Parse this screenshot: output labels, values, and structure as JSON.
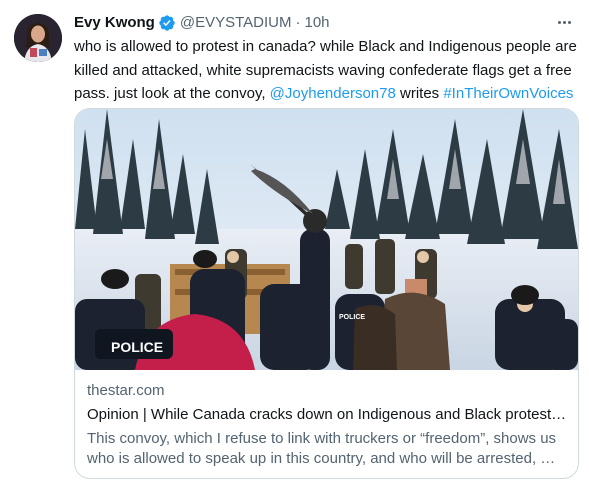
{
  "author": {
    "name": "Evy Kwong",
    "handle": "@EVYSTADIUM",
    "separator": "·",
    "time": "10h",
    "verified": true
  },
  "tweet": {
    "text_part1": "who is allowed to protest in canada? while Black and Indigenous people are killed and attacked, white supremacists waving confederate flags get a free pass. just look at the convoy, ",
    "mention": "@Joyhenderson78",
    "text_part2": " writes ",
    "hashtag": "#InTheirOwnVoices"
  },
  "card": {
    "domain": "thestar.com",
    "title": "Opinion | While Canada cracks down on Indigenous and Black protest…",
    "description": "This convoy, which I refuse to link with truckers or “freedom”, shows us who is allowed to speak up in this country, and who will be arrested, …",
    "image_text": {
      "police_label": "POLICE",
      "police_badge_small": "POLICE"
    }
  },
  "colors": {
    "accent": "#1d9bf0",
    "text_primary": "#0f1419",
    "text_secondary": "#536471",
    "border": "#cfd9de"
  },
  "icons": {
    "verified": "verified-badge-icon",
    "more": "more-options-icon"
  }
}
